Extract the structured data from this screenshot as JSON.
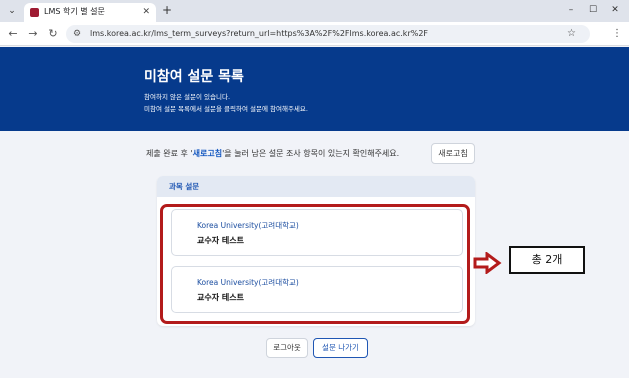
{
  "browser": {
    "tab_title": "LMS 학기 별 설문",
    "url": "lms.korea.ac.kr/lms_term_surveys?return_url=https%3A%2F%2Flms.korea.ac.kr%2F",
    "icons": {
      "tab_dropdown": "⌄",
      "close": "✕",
      "new_tab": "+",
      "minimize": "–",
      "maximize": "☐",
      "window_close": "✕",
      "back": "←",
      "forward": "→",
      "reload": "↻",
      "site_info": "⚙",
      "bookmark": "☆",
      "menu": "⋮"
    }
  },
  "header": {
    "title": "미참여 설문 목록",
    "desc1": "참여하지 않은 설문이 있습니다.",
    "desc2": "미참여 설문 목록에서 설문을 클릭하여 설문에 참여해주세요."
  },
  "notice": {
    "before": "제출 완료 후 '",
    "highlight": "새로고침",
    "after": "'을 눌러 남은 설문 조사 항목이 있는지 확인해주세요."
  },
  "refresh_label": "새로고침",
  "panel_title": "과목 설문",
  "surveys": [
    {
      "org": "Korea University(고려대학교)",
      "name": "교수자 테스트"
    },
    {
      "org": "Korea University(고려대학교)",
      "name": "교수자 테스트"
    }
  ],
  "annotation": {
    "count_label": "총 2개",
    "color": "#b31b1b"
  },
  "footer": {
    "logout_label": "로그아웃",
    "exit_label": "설문 나가기"
  },
  "colors": {
    "header_bg": "#063a8c",
    "accent": "#1f56b3"
  }
}
